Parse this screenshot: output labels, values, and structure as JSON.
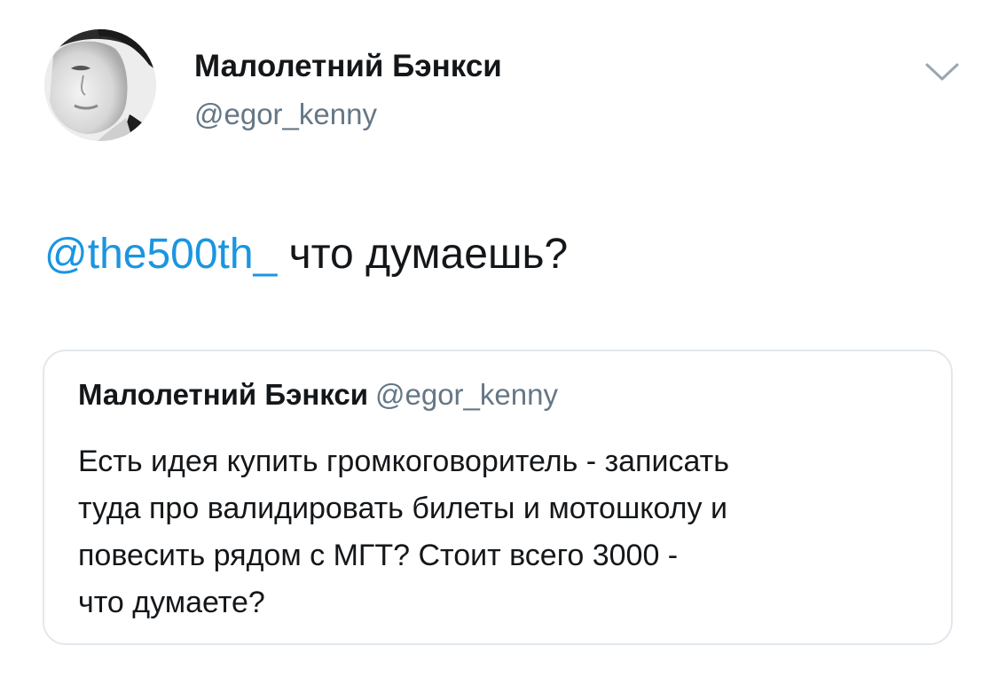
{
  "tweet": {
    "author": {
      "display_name": "Малолетний Бэнкси",
      "handle": "@egor_kenny",
      "avatar_icon": "user-avatar-photo-icon"
    },
    "menu_icon": "chevron-down-icon",
    "text": {
      "mention": "@the500th_",
      "body": " что думаешь?"
    },
    "quoted_tweet": {
      "display_name": "Малолетний Бэнкси",
      "handle": "@egor_kenny",
      "text_lines": [
        "Есть идея купить громкоговоритель - записать",
        "туда про валидировать билеты и мотошколу и",
        "повесить рядом с МГТ? Стоит всего 3000 -",
        "что думаете?"
      ]
    }
  },
  "colors": {
    "text_primary": "#14171a",
    "text_secondary": "#657786",
    "link": "#1b95e0",
    "border": "#e1e8ed",
    "background": "#ffffff"
  }
}
